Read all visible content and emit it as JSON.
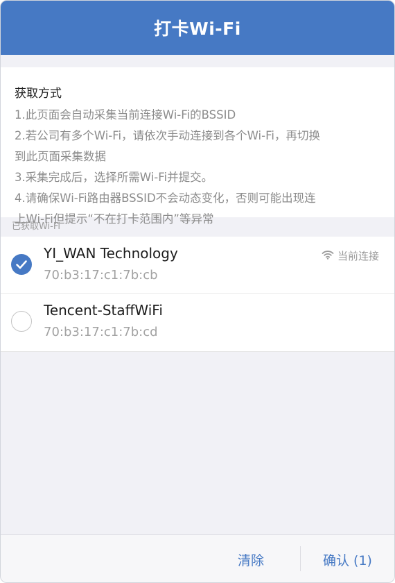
{
  "header": {
    "title": "打卡Wi-Fi"
  },
  "instructions": {
    "title": "获取方式",
    "lines": [
      "1.此页面会自动采集当前连接Wi-Fi的BSSID",
      "2.若公司有多个Wi-Fi，请依次手动连接到各个Wi-Fi，再切换",
      "到此页面采集数据",
      "3.采集完成后，选择所需Wi-Fi并提交。",
      "4.请确保Wi-Fi路由器BSSID不会动态变化，否则可能出现连",
      "上Wi-Fi但提示“不在打卡范围内”等异常"
    ]
  },
  "section": {
    "label": "已获取Wi-Fi"
  },
  "wifi_list": [
    {
      "name": "YI_WAN Technology",
      "bssid": "70:b3:17:c1:7b:cb",
      "checked": true,
      "status": "当前连接",
      "status_icon": "wifi-icon"
    },
    {
      "name": "Tencent-StaffWiFi",
      "bssid": "70:b3:17:c1:7b:cd",
      "checked": false
    }
  ],
  "footer": {
    "clear_label": "清除",
    "confirm_label": "确认 (1)"
  },
  "colors": {
    "accent": "#4679c4",
    "background": "#f1f1f6"
  }
}
